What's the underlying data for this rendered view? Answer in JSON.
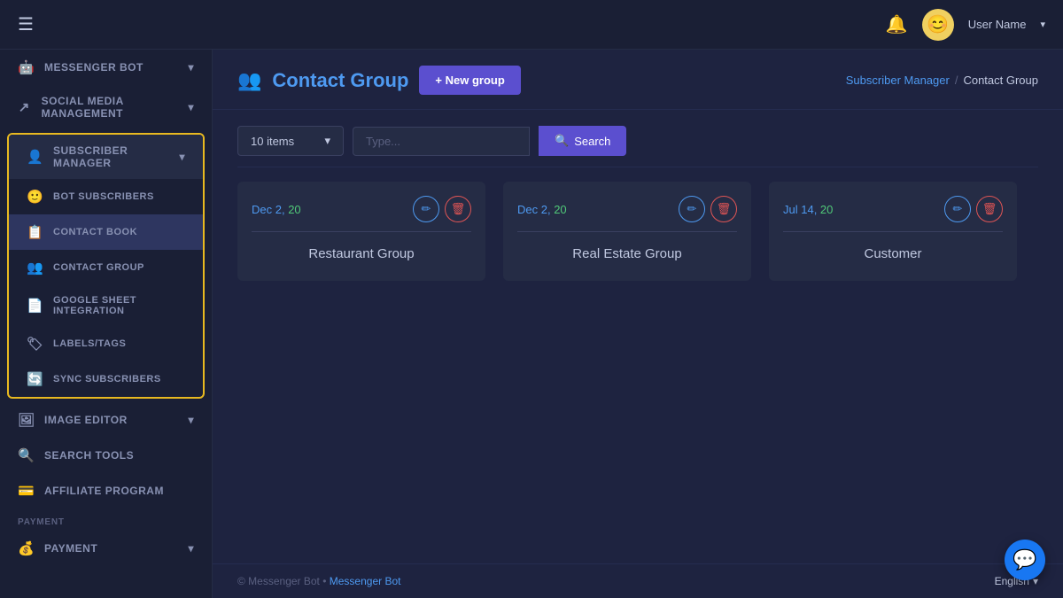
{
  "topbar": {
    "hamburger": "☰",
    "bell": "🔔",
    "avatar_emoji": "😊",
    "user_name": "User Name",
    "chevron": "▾"
  },
  "sidebar": {
    "messenger_bot_label": "MESSENGER BOT",
    "social_media_label": "SOCIAL MEDIA MANAGEMENT",
    "subscriber_manager_label": "SUBSCRIBER MANAGER",
    "bot_subscribers_label": "BOT SUBSCRIBERS",
    "contact_book_label": "CONTACT BOOK",
    "contact_group_label": "CONTACT GROUP",
    "google_sheet_label": "GOOGLE SHEET INTEGRATION",
    "labels_tags_label": "LABELS/TAGS",
    "sync_subscribers_label": "SYNC SUBSCRIBERS",
    "image_editor_label": "IMAGE EDITOR",
    "search_tools_label": "SEARCH TOOLS",
    "affiliate_label": "AFFILIATE PROGRAM",
    "payment_section_label": "PAYMENT",
    "payment_label": "PAYMENT"
  },
  "page": {
    "title": "Contact Group",
    "new_group_btn": "+ New group",
    "breadcrumb_parent": "Subscriber Manager",
    "breadcrumb_sep": "/",
    "breadcrumb_current": "Contact Group"
  },
  "filter": {
    "items_count": "10 items",
    "search_placeholder": "Type...",
    "search_btn": "Search"
  },
  "cards": [
    {
      "date": "Dec 2, 20",
      "name": "Restaurant Group"
    },
    {
      "date": "Dec 2, 20",
      "name": "Real Estate Group"
    },
    {
      "date": "Jul 14, 20",
      "name": "Customer"
    }
  ],
  "footer": {
    "copy": "© Messenger Bot",
    "link": "Messenger Bot",
    "lang": "English"
  },
  "icons": {
    "contact_group": "👥",
    "messenger_bot": "🤖",
    "social_media": "↗",
    "subscriber": "👤",
    "bot_subs": "🙂",
    "contact_book": "📋",
    "contact_group_icon": "👥",
    "google_sheet": "📄",
    "labels": "🏷",
    "sync": "🔄",
    "image_editor": "🖼",
    "search": "🔍",
    "affiliate": "💳",
    "payment": "💰",
    "edit": "✏",
    "delete": "🗑",
    "search_icon": "🔍",
    "chat": "💬"
  }
}
